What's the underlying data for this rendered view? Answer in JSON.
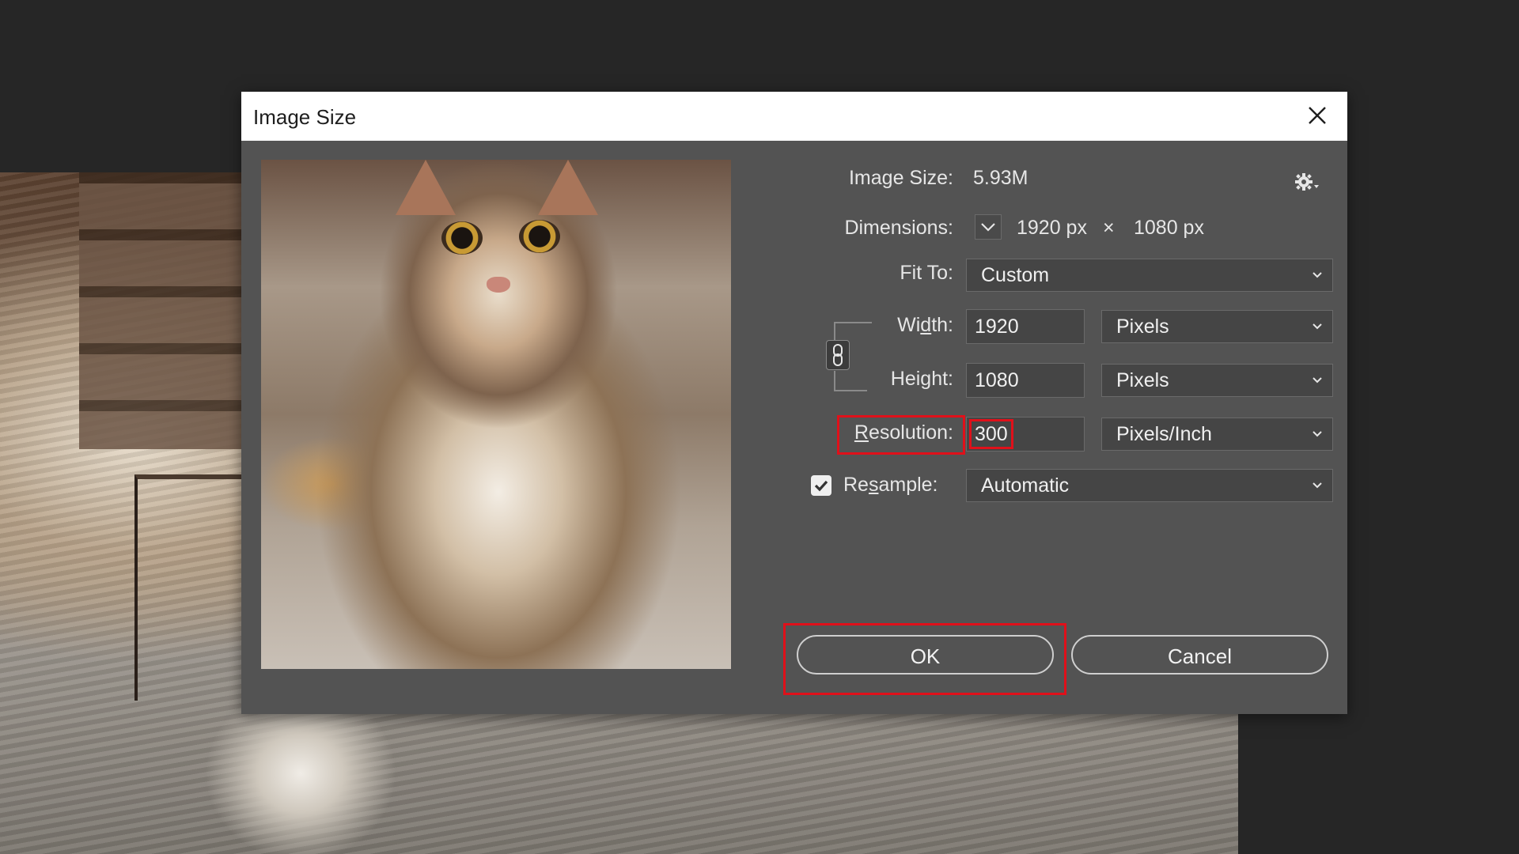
{
  "dialog": {
    "title": "Image Size"
  },
  "info": {
    "image_size_label": "Image Size:",
    "image_size_value": "5.93M",
    "dimensions_label": "Dimensions:",
    "dim_width": "1920 px",
    "dim_times": "×",
    "dim_height": "1080 px"
  },
  "fit_to": {
    "label": "Fit To:",
    "value": "Custom"
  },
  "width": {
    "label_pre": "Wi",
    "label_mn": "d",
    "label_post": "th:",
    "value": "1920",
    "unit": "Pixels"
  },
  "height": {
    "label_pre": "Hei",
    "label_mn": "g",
    "label_post": "ht:",
    "value": "1080",
    "unit": "Pixels"
  },
  "resolution": {
    "label_mn": "R",
    "label_post": "esolution:",
    "value": "300",
    "unit": "Pixels/Inch"
  },
  "resample": {
    "label_pre": "Re",
    "label_mn": "s",
    "label_post": "ample:",
    "checked": true,
    "value": "Automatic"
  },
  "buttons": {
    "ok": "OK",
    "cancel": "Cancel"
  },
  "colors": {
    "dialog_bg": "#535353",
    "highlight": "#e0101a"
  },
  "icons": [
    "close-icon",
    "gear-icon",
    "chevron-down-icon",
    "chain-link-icon",
    "checkmark-icon"
  ]
}
